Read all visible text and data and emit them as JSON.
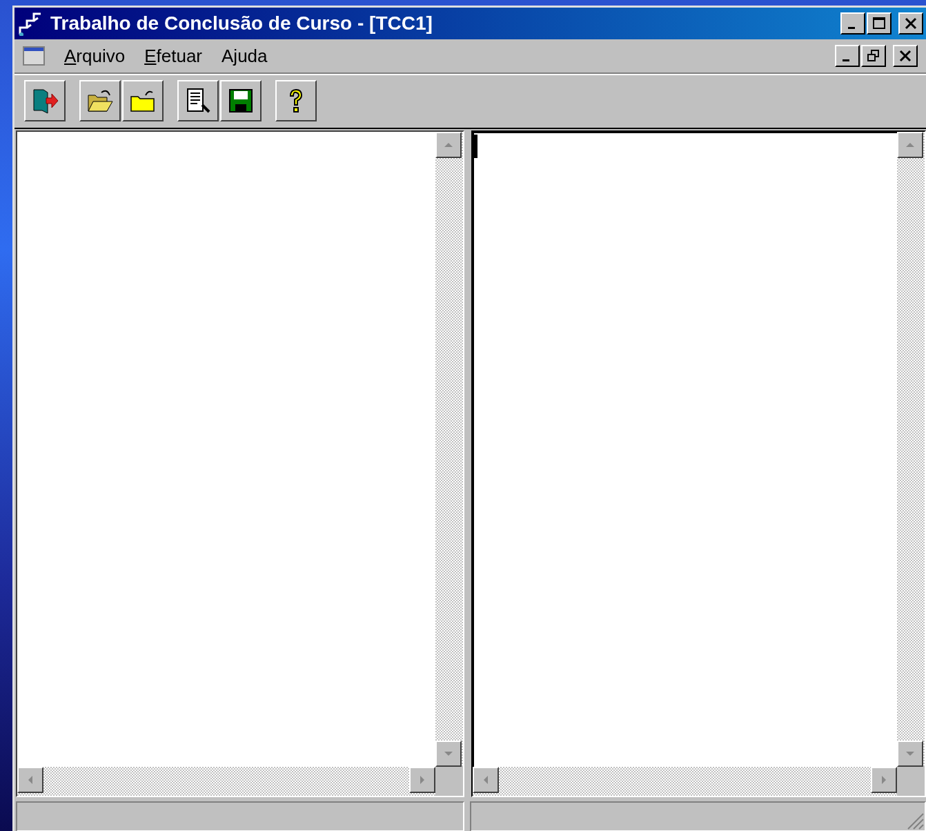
{
  "window": {
    "title": "Trabalho de Conclusão de Curso - [TCC1]"
  },
  "menu": [
    {
      "label": "Arquivo",
      "underlined_first": true
    },
    {
      "label": "Efetuar",
      "underlined_first": true
    },
    {
      "label": "Ajuda",
      "underlined_first": false
    }
  ],
  "toolbar": [
    {
      "buttons": [
        {
          "kind": "exit"
        }
      ]
    },
    {
      "buttons": [
        {
          "kind": "open"
        },
        {
          "kind": "folder"
        }
      ]
    },
    {
      "buttons": [
        {
          "kind": "preview"
        },
        {
          "kind": "save"
        }
      ]
    },
    {
      "buttons": [
        {
          "kind": "help"
        }
      ]
    }
  ],
  "panes": [
    {
      "focused": false
    },
    {
      "focused": true
    }
  ]
}
